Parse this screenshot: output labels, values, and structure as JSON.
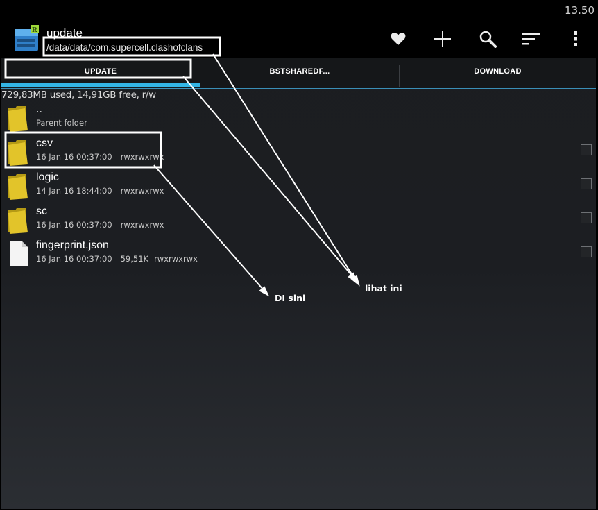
{
  "status_bar": {
    "time": "13.50"
  },
  "action_bar": {
    "title": "update",
    "path": "/data/data/com.supercell.clashofclans",
    "icons": [
      "heart-icon",
      "plus-icon",
      "search-icon",
      "sort-icon",
      "overflow-menu-icon"
    ]
  },
  "tabs": [
    {
      "label": "UPDATE",
      "selected": true
    },
    {
      "label": "BSTSHAREDF..."
    },
    {
      "label": "DOWNLOAD"
    }
  ],
  "storage_info": "729,83MB used, 14,91GB free, r/w",
  "files": [
    {
      "name": "..",
      "date": "Parent folder",
      "size": "",
      "perms": "",
      "type": "folder"
    },
    {
      "name": "csv",
      "date": "16 Jan 16 00:37:00",
      "size": "",
      "perms": "rwxrwxrwx",
      "type": "folder"
    },
    {
      "name": "logic",
      "date": "14 Jan 16 18:44:00",
      "size": "",
      "perms": "rwxrwxrwx",
      "type": "folder"
    },
    {
      "name": "sc",
      "date": "16 Jan 16 00:37:00",
      "size": "",
      "perms": "rwxrwxrwx",
      "type": "folder"
    },
    {
      "name": "fingerprint.json",
      "date": "16 Jan 16 00:37:00",
      "size": "59,51K",
      "perms": "rwxrwxrwx",
      "type": "file"
    }
  ],
  "annotations": {
    "di_sini": "DI sini",
    "lihat_ini": "lihat ini"
  },
  "colors": {
    "accent": "#33b5e5",
    "folder": "#e2c42a",
    "background": "#1c1e22"
  }
}
